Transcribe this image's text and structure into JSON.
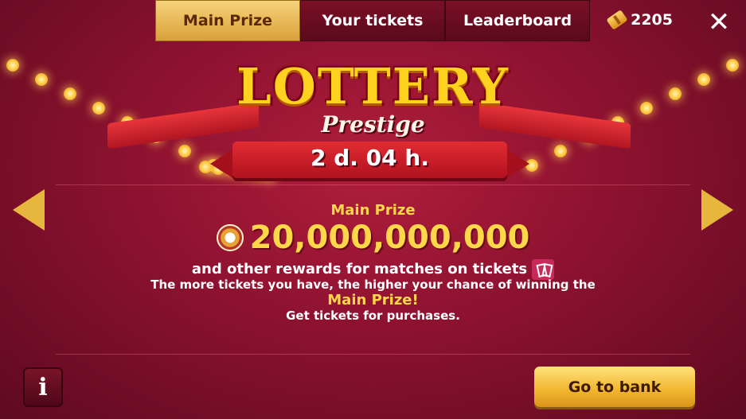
{
  "tabs": [
    {
      "label": "Main Prize",
      "active": true
    },
    {
      "label": "Your tickets",
      "active": false
    },
    {
      "label": "Leaderboard",
      "active": false
    }
  ],
  "header": {
    "ticket_balance": "2205",
    "close_icon": "close-icon"
  },
  "banner": {
    "title": "LOTTERY",
    "subtitle": "Prestige",
    "timer": "2 d. 04 h."
  },
  "prize": {
    "label": "Main Prize",
    "amount": "20,000,000,000",
    "line1": "and other rewards for matches on tickets",
    "line2": "The more tickets you have, the higher your chance of winning the",
    "line3": "Main Prize!",
    "line4": "Get tickets for purchases."
  },
  "buttons": {
    "info": "i",
    "bank": "Go to bank"
  },
  "colors": {
    "accent_gold": "#ffd84a",
    "background": "#8d1230"
  }
}
